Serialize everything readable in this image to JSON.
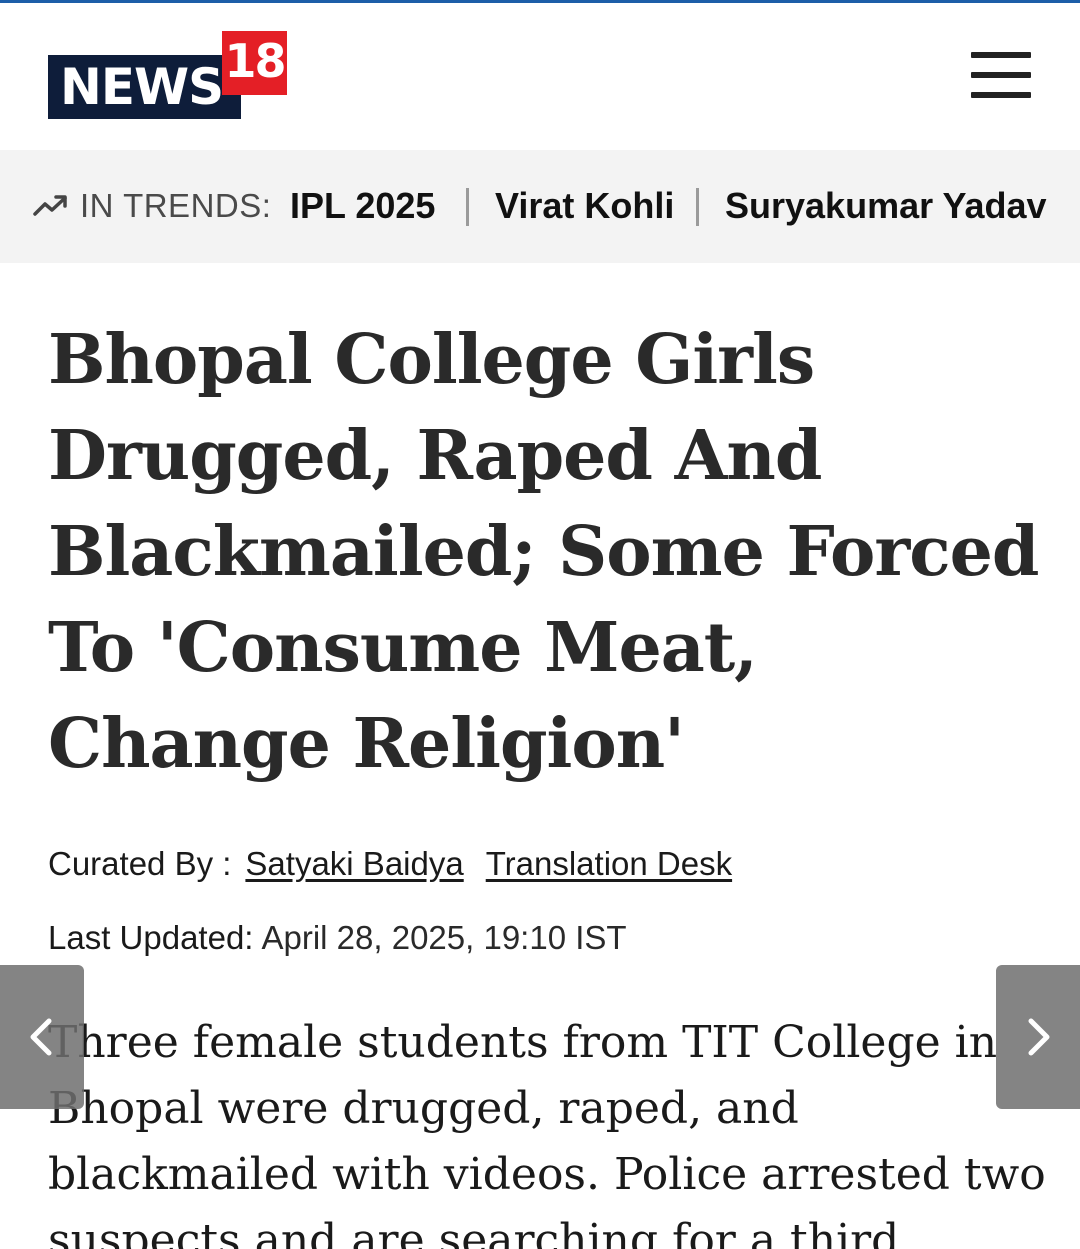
{
  "header": {
    "logo_news": "NEWS",
    "logo_number": "18",
    "menu_icon": "hamburger-menu-icon"
  },
  "trends": {
    "icon": "trending-up-icon",
    "label": "IN TRENDS:",
    "items": [
      "IPL 2025",
      "Virat Kohli",
      "Suryakumar Yadav"
    ]
  },
  "article": {
    "headline": "Bhopal College Girls Drugged, Raped And Blackmailed; Some Forced To 'Consume Meat, Change Religion'",
    "curated_by_label": "Curated By :",
    "authors": [
      "Satyaki Baidya",
      "Translation Desk"
    ],
    "last_updated_label": "Last Updated:",
    "last_updated_value": "April 28, 2025, 19:10 IST",
    "summary": "Three female students from TIT College in Bhopal were drugged, raped, and blackmailed with videos. Police arrested two suspects and are searching for a third."
  },
  "nav": {
    "prev_icon": "chevron-left-icon",
    "next_icon": "chevron-right-icon"
  },
  "colors": {
    "brand_navy": "#0e1d3a",
    "brand_red": "#e41f26",
    "top_line": "#1c5ea8",
    "trends_bg": "#f3f3f3"
  }
}
